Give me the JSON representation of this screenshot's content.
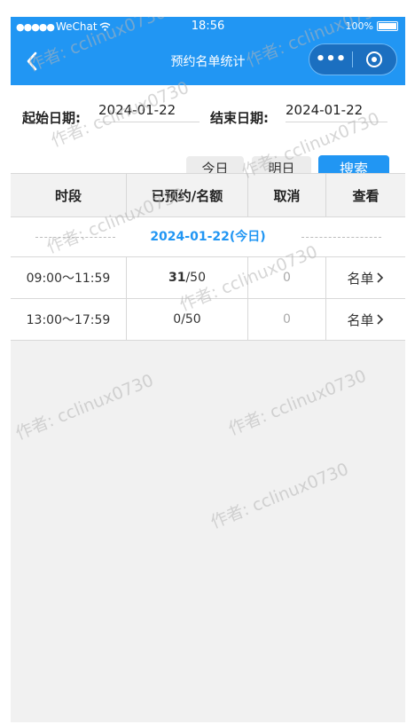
{
  "status_bar": {
    "carrier": "WeChat",
    "time": "18:56",
    "battery": "100%"
  },
  "navbar": {
    "title": "预约名单统计",
    "menu_glyph": "•••"
  },
  "form": {
    "start_label": "起始日期:",
    "start_value": "2024-01-22",
    "end_label": "结束日期:",
    "end_value": "2024-01-22",
    "today_button": "今日",
    "tomorrow_button": "明日",
    "search_button": "搜索"
  },
  "table": {
    "headers": [
      "时段",
      "已预约/名额",
      "取消",
      "查看"
    ],
    "date_group": "2024-01-22(今日)",
    "rows": [
      {
        "period": "09:00～11:59",
        "booked": "31",
        "quota": "/50",
        "cancel": "0",
        "view": "名单"
      },
      {
        "period": "13:00～17:59",
        "booked": "0",
        "quota": "/50",
        "cancel": "0",
        "view": "名单"
      }
    ]
  },
  "watermark": "作者: cclinux0730",
  "colors": {
    "accent": "#2196f3",
    "background": "#f1f1f1"
  }
}
